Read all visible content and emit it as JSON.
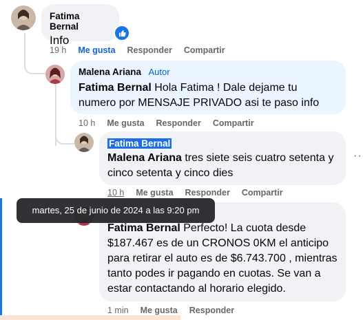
{
  "comments": [
    {
      "name": "Fatima Bernal",
      "text": "Info",
      "time": "19 h",
      "like": "Me gusta",
      "reply": "Responder",
      "share": "Compartir"
    },
    {
      "name": "Malena Ariana",
      "badge": "Autor",
      "mention": "Fatima Bernal",
      "text": " Hola Fatima ! Dale dejame tu numero por MENSAJE PRIVADO asi te paso info",
      "time": "10 h",
      "like": "Me gusta",
      "reply": "Responder",
      "share": "Compartir"
    },
    {
      "name": "Fatima Bernal",
      "mention": "Malena Ariana",
      "text": " tres siete seis cuatro setenta y cinco setenta y cinco dies",
      "time": "10 h",
      "like": "Me gusta",
      "reply": "Responder",
      "share": "Compartir"
    },
    {
      "mention": "Fatima Bernal",
      "text": " Perfecto! La cuota desde $187.467 es de un CRONOS 0KM el anticipo para retirar el auto es de $6.743.700 , mientras tanto podes ir pagando en cuotas. Se van a estar contactando al horario elegido.",
      "time": "1 min",
      "like": "Me gusta",
      "reply": "Responder"
    }
  ],
  "tooltip": "martes, 25 de junio de 2024 a las 9:20 pm",
  "more_options": "···",
  "colors": {
    "bubble": "#f0f2f5",
    "author_bubble": "#ebf5ff",
    "link": "#1261d4",
    "author_tag": "#0064d1"
  }
}
